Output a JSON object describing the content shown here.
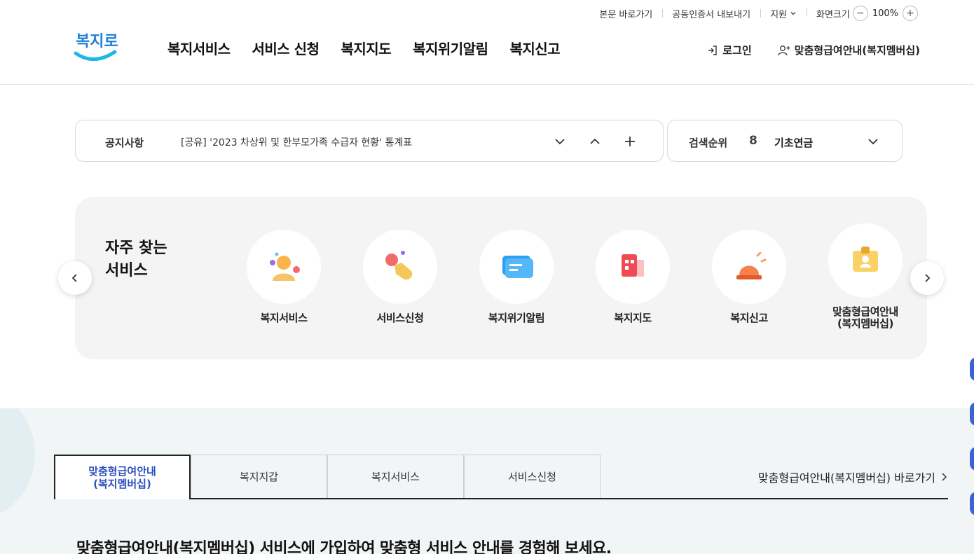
{
  "util": {
    "skip_link": "본문 바로가기",
    "cert_export": "공동인증서 내보내기",
    "support": "지원",
    "zoom_label": "화면크기",
    "zoom_value": "100%",
    "zoom_minus": "−",
    "zoom_plus": "+"
  },
  "logo": {
    "text": "복지로"
  },
  "gnb": {
    "items": [
      "복지서비스",
      "서비스 신청",
      "복지지도",
      "복지위기알림",
      "복지신고"
    ]
  },
  "header_right": {
    "login": "로그인",
    "membership": "맞춤형급여안내(복지멤버십)"
  },
  "notice": {
    "label": "공지사항",
    "text": "[공유] '2023 차상위 및 한부모가족 수급자 현황' 통계표"
  },
  "rank": {
    "label": "검색순위",
    "number": "8",
    "keyword": "기초연금"
  },
  "frequent": {
    "title_line1": "자주 찾는",
    "title_line2": "서비스",
    "items": [
      {
        "label": "복지서비스",
        "icon": "person-icon"
      },
      {
        "label": "서비스신청",
        "icon": "hand-pointer-icon"
      },
      {
        "label": "복지위기알림",
        "icon": "message-icon"
      },
      {
        "label": "복지지도",
        "icon": "map-grid-icon"
      },
      {
        "label": "복지신고",
        "icon": "siren-icon"
      },
      {
        "label": "맞춤형급여안내\n(복지멤버십)",
        "icon": "id-badge-icon"
      }
    ]
  },
  "tabs": {
    "items": [
      "맞춤형급여안내\n(복지멤버십)",
      "복지지갑",
      "복지서비스",
      "서비스신청"
    ],
    "go_link": "맞춤형급여안내(복지멤버십) 바로가기"
  },
  "tagline": "맞춤형급여안내(복지멤버십) 서비스에 가입하여 맞춤형 서비스 안내를 경험해 보세요.",
  "colors": {
    "brand_blue": "#2b4fbf",
    "logo_blue": "#1f7fd8",
    "logo_cyan": "#1eb7e6",
    "panel_bg": "#f4f4f4",
    "lower_bg": "#f1f5f6"
  }
}
